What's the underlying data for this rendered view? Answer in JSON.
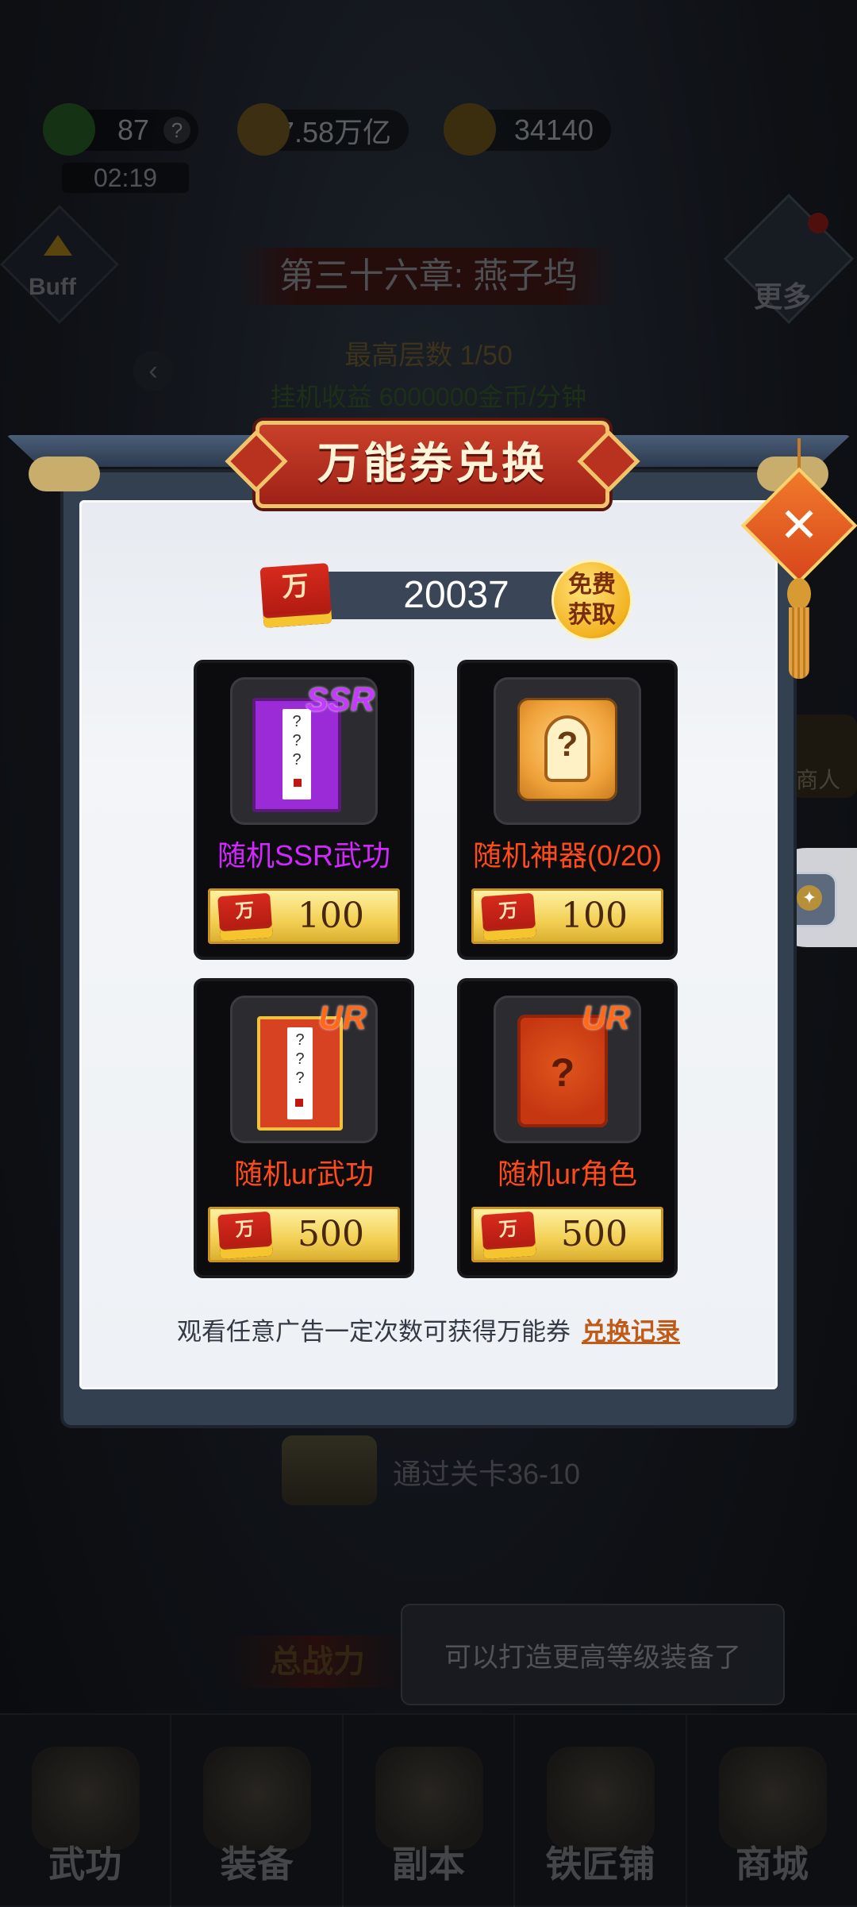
{
  "hud": {
    "energy": "87",
    "energy_help": "?",
    "coins": "7.58万亿",
    "gold": "34140",
    "timer": "02:19",
    "buff_label": "Buff",
    "more_label": "更多",
    "chapter": "第三十六章: 燕子坞",
    "max_floor": "最高层数 1/50",
    "idle_income": "挂机收益 6000000金币/分钟",
    "back_glyph": "‹"
  },
  "background": {
    "chest_label": "通过关卡36-10",
    "power_label": "总战力",
    "merchant_label": "商人",
    "toast": "可以打造更高等级装备了"
  },
  "bottom_nav": [
    {
      "label": "武功"
    },
    {
      "label": "装备"
    },
    {
      "label": "副本"
    },
    {
      "label": "铁匠铺"
    },
    {
      "label": "商城"
    }
  ],
  "dialog": {
    "title": "万能券兑换",
    "close_glyph": "✕",
    "ticket_glyph": "万",
    "ticket_balance": "20037",
    "free_get": "免费获取",
    "items": [
      {
        "rarity": "SSR",
        "name": "随机SSR武功",
        "price": "100",
        "icon": "ssr-scroll-icon",
        "rarity_color": "#c43bff",
        "name_color": "#d327ff"
      },
      {
        "rarity": "",
        "name": "随机神器(0/20)",
        "price": "100",
        "icon": "artifact-helmet-icon",
        "rarity_color": "",
        "name_color": "#ff4a1a"
      },
      {
        "rarity": "UR",
        "name": "随机ur武功",
        "price": "500",
        "icon": "ur-scroll-icon",
        "rarity_color": "#ff6a1a",
        "name_color": "#ff4a1a"
      },
      {
        "rarity": "UR",
        "name": "随机ur角色",
        "price": "500",
        "icon": "ur-character-card-icon",
        "rarity_color": "#ff6a1a",
        "name_color": "#ff4a1a"
      }
    ],
    "footer_text": "观看任意广告一定次数可获得万能券",
    "history_link": "兑换记录"
  }
}
